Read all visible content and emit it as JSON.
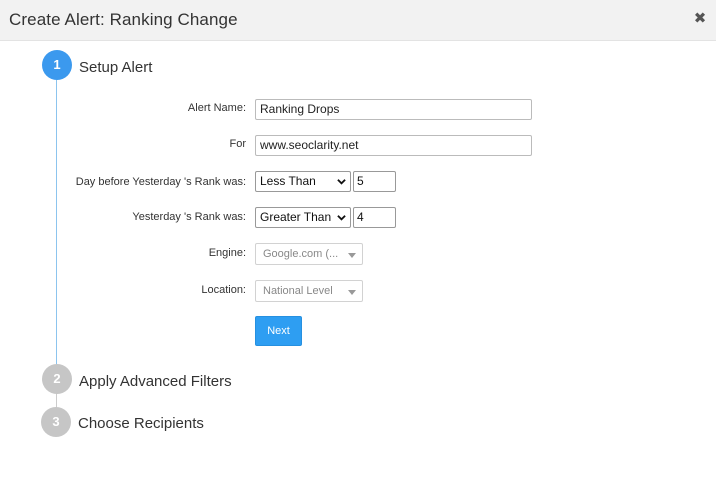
{
  "dialog": {
    "title": "Create Alert: Ranking Change",
    "close_glyph": "✖"
  },
  "steps": [
    {
      "number": "1",
      "label": "Setup Alert",
      "state": "active",
      "color": "#3b99ee"
    },
    {
      "number": "2",
      "label": "Apply Advanced Filters",
      "state": "inactive",
      "color": "#c6c6c6"
    },
    {
      "number": "3",
      "label": "Choose Recipients",
      "state": "inactive",
      "color": "#c6c6c6"
    }
  ],
  "form": {
    "alert_name": {
      "label": "Alert Name:",
      "value": "Ranking Drops"
    },
    "for": {
      "label": "For",
      "value": "www.seoclarity.net"
    },
    "day_before": {
      "label": "Day before Yesterday 's Rank was:",
      "operator": "Less Than",
      "value": "5"
    },
    "yesterday": {
      "label": "Yesterday 's Rank was:",
      "operator": "Greater Than",
      "value": "4"
    },
    "engine": {
      "label": "Engine:",
      "value": "Google.com (..."
    },
    "location": {
      "label": "Location:",
      "value": "National Level"
    },
    "next_label": "Next"
  },
  "colors": {
    "accent": "#3b99ee",
    "button": "#2e9ef2",
    "header_bg": "#f2f2f2",
    "inactive_step": "#c6c6c6"
  }
}
